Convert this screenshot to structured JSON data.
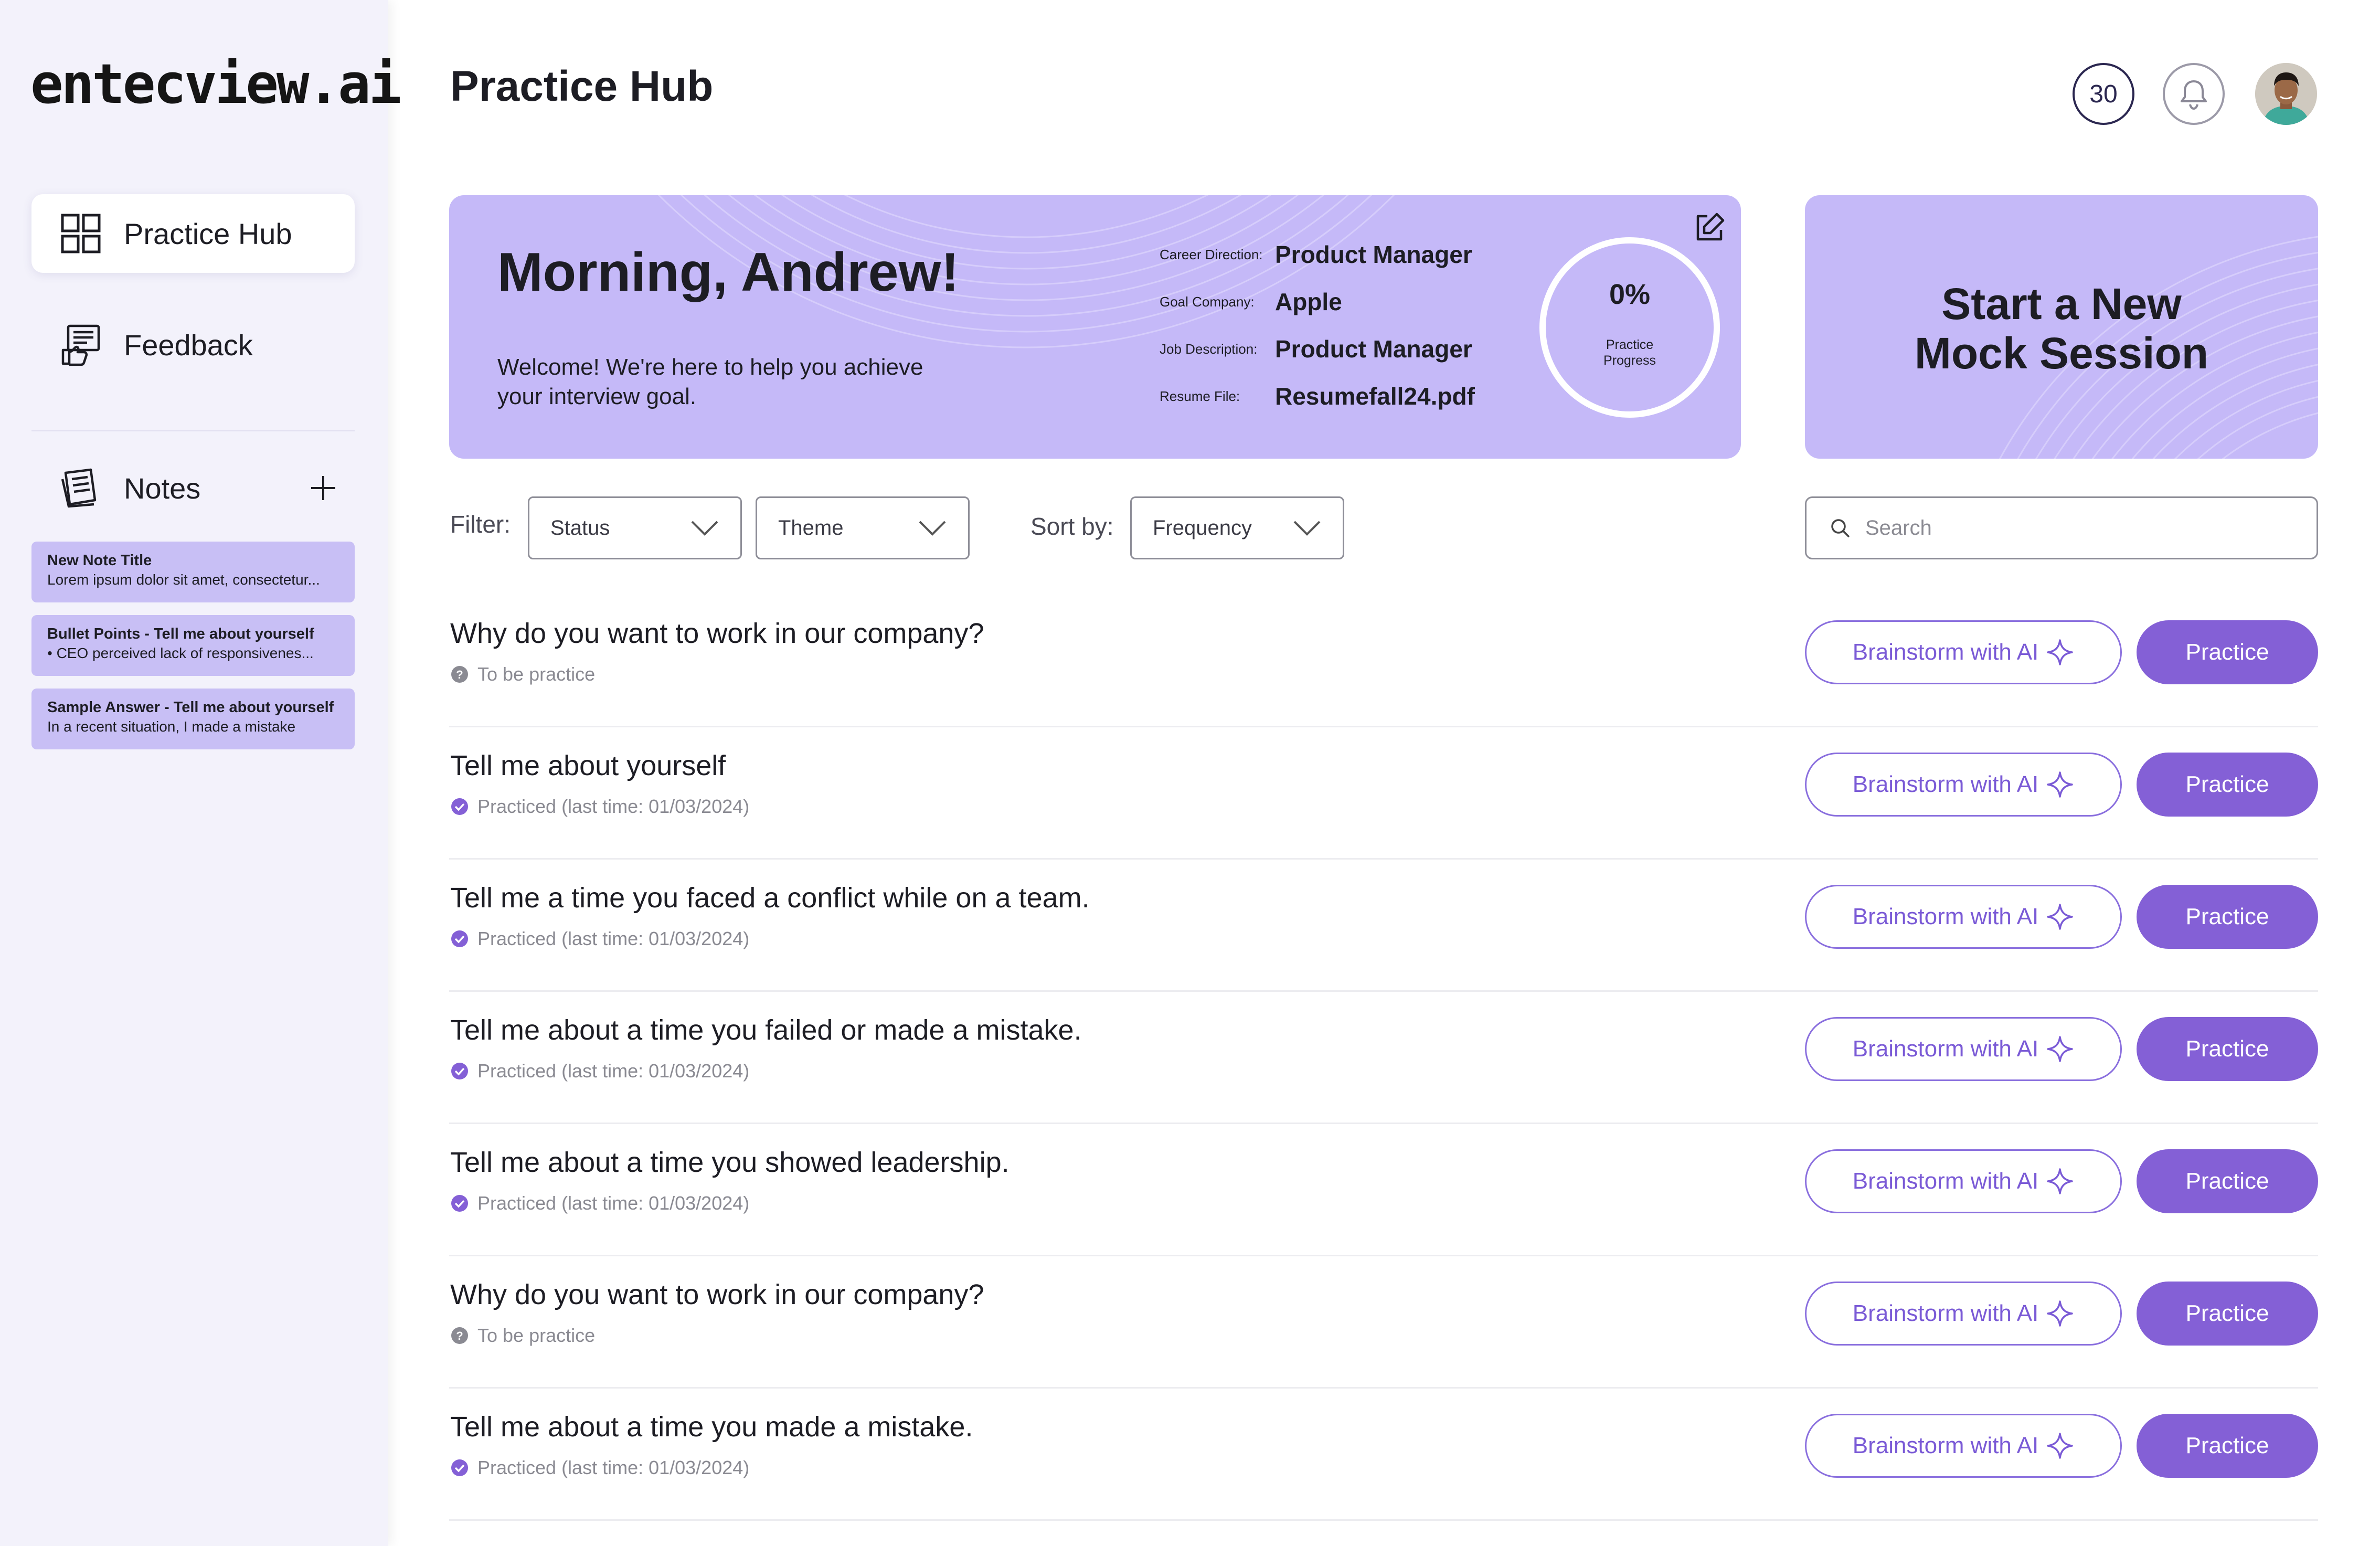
{
  "app": {
    "logo": "entecview.ai",
    "page_title": "Practice Hub"
  },
  "sidebar": {
    "nav": [
      {
        "label": "Practice Hub",
        "icon": "grid-icon",
        "active": true
      },
      {
        "label": "Feedback",
        "icon": "feedback-icon",
        "active": false
      }
    ],
    "notes_label": "Notes",
    "notes": [
      {
        "title": "New Note Title",
        "body": "Lorem ipsum dolor sit amet, consectetur..."
      },
      {
        "title": "Bullet Points - Tell me about yourself",
        "body": "•  CEO perceived lack of responsivenes..."
      },
      {
        "title": "Sample Answer - Tell me about yourself",
        "body": "In a recent situation, I made a mistake"
      }
    ]
  },
  "header": {
    "credits": "30"
  },
  "welcome": {
    "greeting": "Morning, Andrew!",
    "message": "Welcome! We're here to help you achieve your interview goal.",
    "info": [
      {
        "label": "Career Direction:",
        "value": "Product Manager"
      },
      {
        "label": "Goal Company:",
        "value": "Apple"
      },
      {
        "label": "Job Description:",
        "value": "Product Manager"
      },
      {
        "label": "Resume File:",
        "value": "Resumefall24.pdf"
      }
    ],
    "progress_value": "0%",
    "progress_fraction": 0,
    "progress_label": "Practice Progress"
  },
  "mock": {
    "label_line1": "Start a New",
    "label_line2": "Mock Session"
  },
  "filters": {
    "filter_label": "Filter:",
    "status": "Status",
    "theme": "Theme",
    "sort_label": "Sort by:",
    "sort": "Frequency",
    "search_placeholder": "Search"
  },
  "questions": [
    {
      "title": "Why do you want to work in our company?",
      "status": "To be practice",
      "practiced": false
    },
    {
      "title": "Tell me about yourself",
      "status": "Practiced (last time: 01/03/2024)",
      "practiced": true
    },
    {
      "title": "Tell me a time you faced a conflict while on a team.",
      "status": "Practiced (last time: 01/03/2024)",
      "practiced": true
    },
    {
      "title": "Tell me about a time you failed or made a mistake.",
      "status": "Practiced (last time: 01/03/2024)",
      "practiced": true
    },
    {
      "title": "Tell me about a time you showed leadership.",
      "status": "Practiced (last time: 01/03/2024)",
      "practiced": true
    },
    {
      "title": "Why do you want to work in our company?",
      "status": "To be practice",
      "practiced": false
    },
    {
      "title": "Tell me about a time you made a mistake.",
      "status": "Practiced (last time: 01/03/2024)",
      "practiced": true
    }
  ],
  "actions": {
    "brainstorm_label": "Brainstorm with AI",
    "practice_label": "Practice"
  },
  "colors": {
    "accent": "#8460d6",
    "card": "#c5b9f8",
    "note": "#c8bff5",
    "sidebar": "#f3f2fb"
  }
}
